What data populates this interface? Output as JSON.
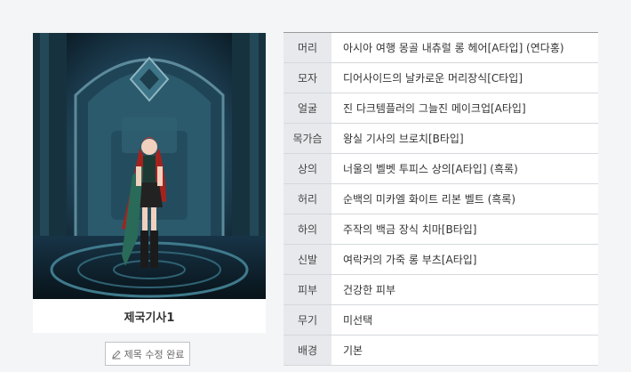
{
  "character": {
    "name": "제국기사1",
    "edit_button_label": "제목 수정 완료"
  },
  "equipment": [
    {
      "slot": "머리",
      "item": "아시아 여행 몽골 내츄럴 롱 헤어[A타입] (연다홍)"
    },
    {
      "slot": "모자",
      "item": "디어사이드의 날카로운 머리장식[C타입]"
    },
    {
      "slot": "얼굴",
      "item": "진 다크템플러의 그늘진 메이크업[A타입]"
    },
    {
      "slot": "목가슴",
      "item": "왕실 기사의 브로치[B타입]"
    },
    {
      "slot": "상의",
      "item": "너울의 벨벳 투피스 상의[A타입] (흑록)"
    },
    {
      "slot": "허리",
      "item": "순백의 미카엘 화이트 리본 벨트 (흑록)"
    },
    {
      "slot": "하의",
      "item": "주작의 백금 장식 치마[B타입]"
    },
    {
      "slot": "신발",
      "item": "여락커의 가죽 롱 부츠[A타입]"
    },
    {
      "slot": "피부",
      "item": "건강한 피부"
    },
    {
      "slot": "무기",
      "item": "미선택"
    },
    {
      "slot": "배경",
      "item": "기본"
    }
  ]
}
